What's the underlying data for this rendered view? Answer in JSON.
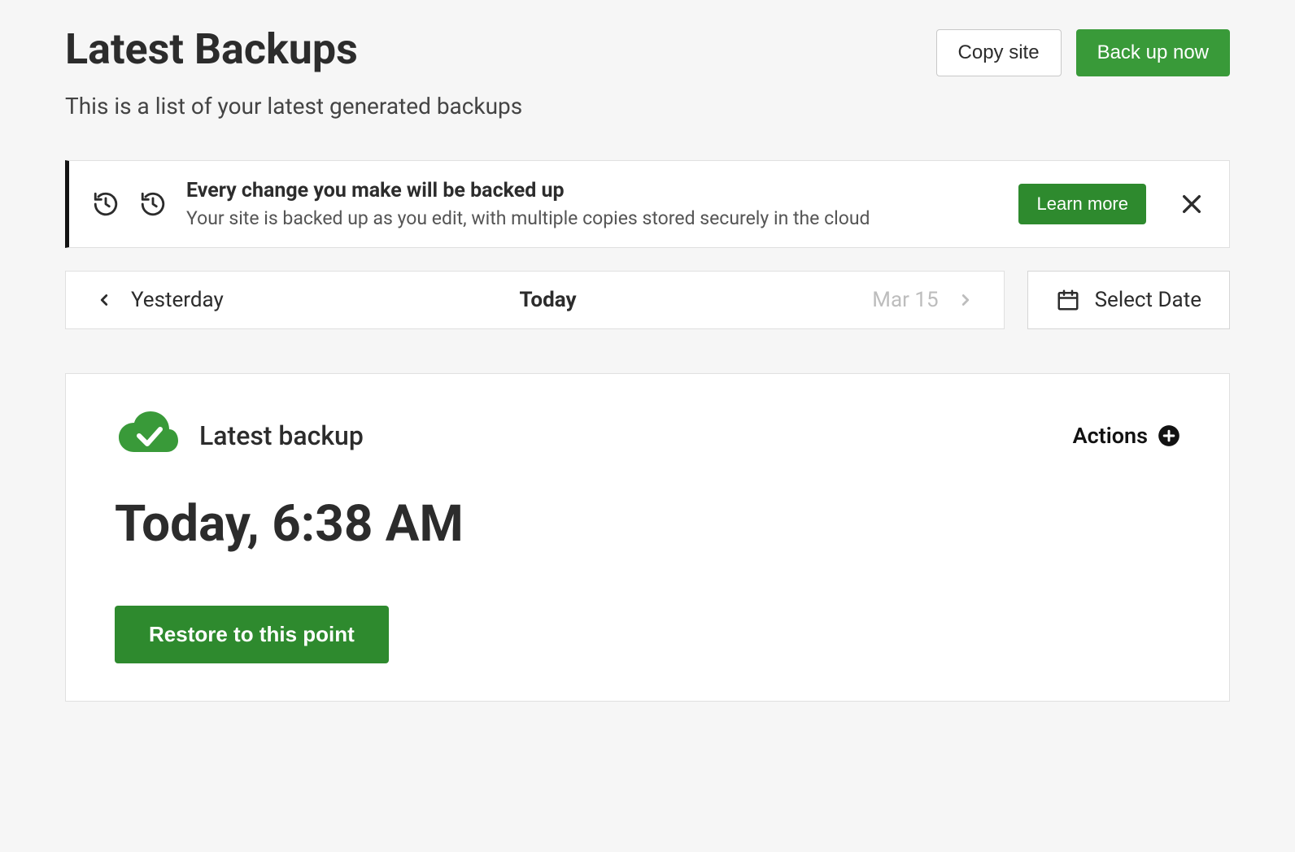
{
  "header": {
    "title": "Latest Backups",
    "subtitle": "This is a list of your latest generated backups",
    "copy_label": "Copy site",
    "backup_label": "Back up now"
  },
  "banner": {
    "title": "Every change you make will be backed up",
    "description": "Your site is backed up as you edit, with multiple copies stored securely in the cloud",
    "learn_more_label": "Learn more"
  },
  "date_nav": {
    "prev_label": "Yesterday",
    "current_label": "Today",
    "next_label": "Mar 15",
    "select_date_label": "Select Date"
  },
  "backup_card": {
    "title": "Latest backup",
    "actions_label": "Actions",
    "time": "Today, 6:38 AM",
    "restore_label": "Restore to this point"
  },
  "colors": {
    "primary_green": "#399a39",
    "dark_green": "#2e8a2e"
  }
}
